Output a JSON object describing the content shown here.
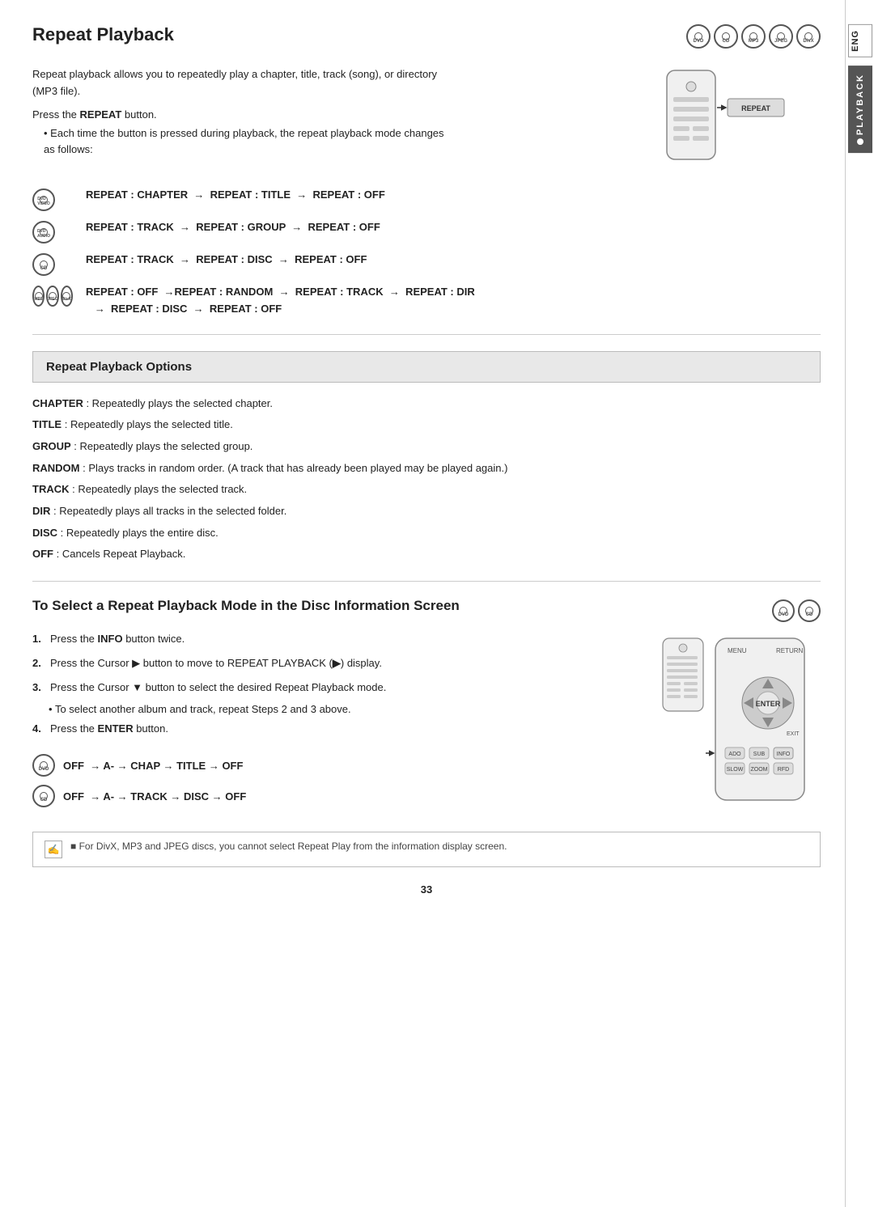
{
  "page": {
    "number": "33",
    "lang_label": "ENG",
    "section_label": "PLAYBACK"
  },
  "header": {
    "title": "Repeat Playback",
    "disc_icons": [
      "DVD",
      "CD",
      "MP3",
      "JPEG",
      "DivX"
    ]
  },
  "intro": {
    "text": "Repeat playback allows you to repeatedly play a chapter, title, track (song), or directory (MP3 file).",
    "press_label": "Press the ",
    "press_button": "REPEAT",
    "press_after": " button.",
    "bullet": "Each time the button is pressed during playback, the repeat playback mode changes as follows:"
  },
  "repeat_modes": [
    {
      "icons": [
        "DVD-VIDEO"
      ],
      "sequence": "REPEAT : CHAPTER → REPEAT : TITLE → REPEAT : OFF"
    },
    {
      "icons": [
        "DVD-AUDIO"
      ],
      "sequence": "REPEAT : TRACK → REPEAT : GROUP → REPEAT : OFF"
    },
    {
      "icons": [
        "CD"
      ],
      "sequence": "REPEAT : TRACK → REPEAT : DISC → REPEAT : OFF"
    },
    {
      "icons": [
        "MP3",
        "JPEG",
        "DivX"
      ],
      "sequence": "REPEAT : OFF →REPEAT : RANDOM → REPEAT : TRACK → REPEAT : DIR → REPEAT : DISC → REPEAT : OFF"
    }
  ],
  "options_section": {
    "title": "Repeat Playback Options",
    "items": [
      {
        "term": "CHAPTER",
        "desc": ": Repeatedly plays the selected chapter."
      },
      {
        "term": "TITLE",
        "desc": ": Repeatedly plays the selected title."
      },
      {
        "term": "GROUP",
        "desc": ": Repeatedly plays the selected group."
      },
      {
        "term": "RANDOM",
        "desc": ": Plays tracks in random order. (A track that has already been played may be played again.)"
      },
      {
        "term": "TRACK",
        "desc": ": Repeatedly plays the selected track."
      },
      {
        "term": "DIR",
        "desc": ": Repeatedly plays all tracks in the selected folder."
      },
      {
        "term": "DISC",
        "desc": ": Repeatedly plays the entire disc."
      },
      {
        "term": "OFF",
        "desc": ": Cancels Repeat Playback."
      }
    ]
  },
  "select_section": {
    "title": "To Select a Repeat Playback Mode in the Disc Information Screen",
    "disc_icons": [
      "DVD",
      "CD"
    ],
    "steps": [
      {
        "num": "1.",
        "text": "Press the ",
        "bold": "INFO",
        "after": " button twice."
      },
      {
        "num": "2.",
        "text": "Press the Cursor ▶ button to move to REPEAT PLAYBACK (",
        "bold": "c",
        "after": ") display."
      },
      {
        "num": "3.",
        "text": "Press the Cursor ▼ button to select the desired Repeat Playback mode."
      },
      {
        "num": "4.",
        "text": "Press the ",
        "bold": "ENTER",
        "after": " button."
      }
    ],
    "step3_bullet": "To select another album and track, repeat Steps 2 and 3 above."
  },
  "sequences": [
    {
      "icon": "DVD",
      "text": "OFF → A- → CHAP → TITLE → OFF"
    },
    {
      "icon": "CD",
      "text": "OFF → A- → TRACK → DISC → OFF"
    }
  ],
  "note": {
    "icon": "✍",
    "text": "■  For DivX, MP3 and JPEG discs, you cannot select Repeat Play from the information display screen."
  }
}
